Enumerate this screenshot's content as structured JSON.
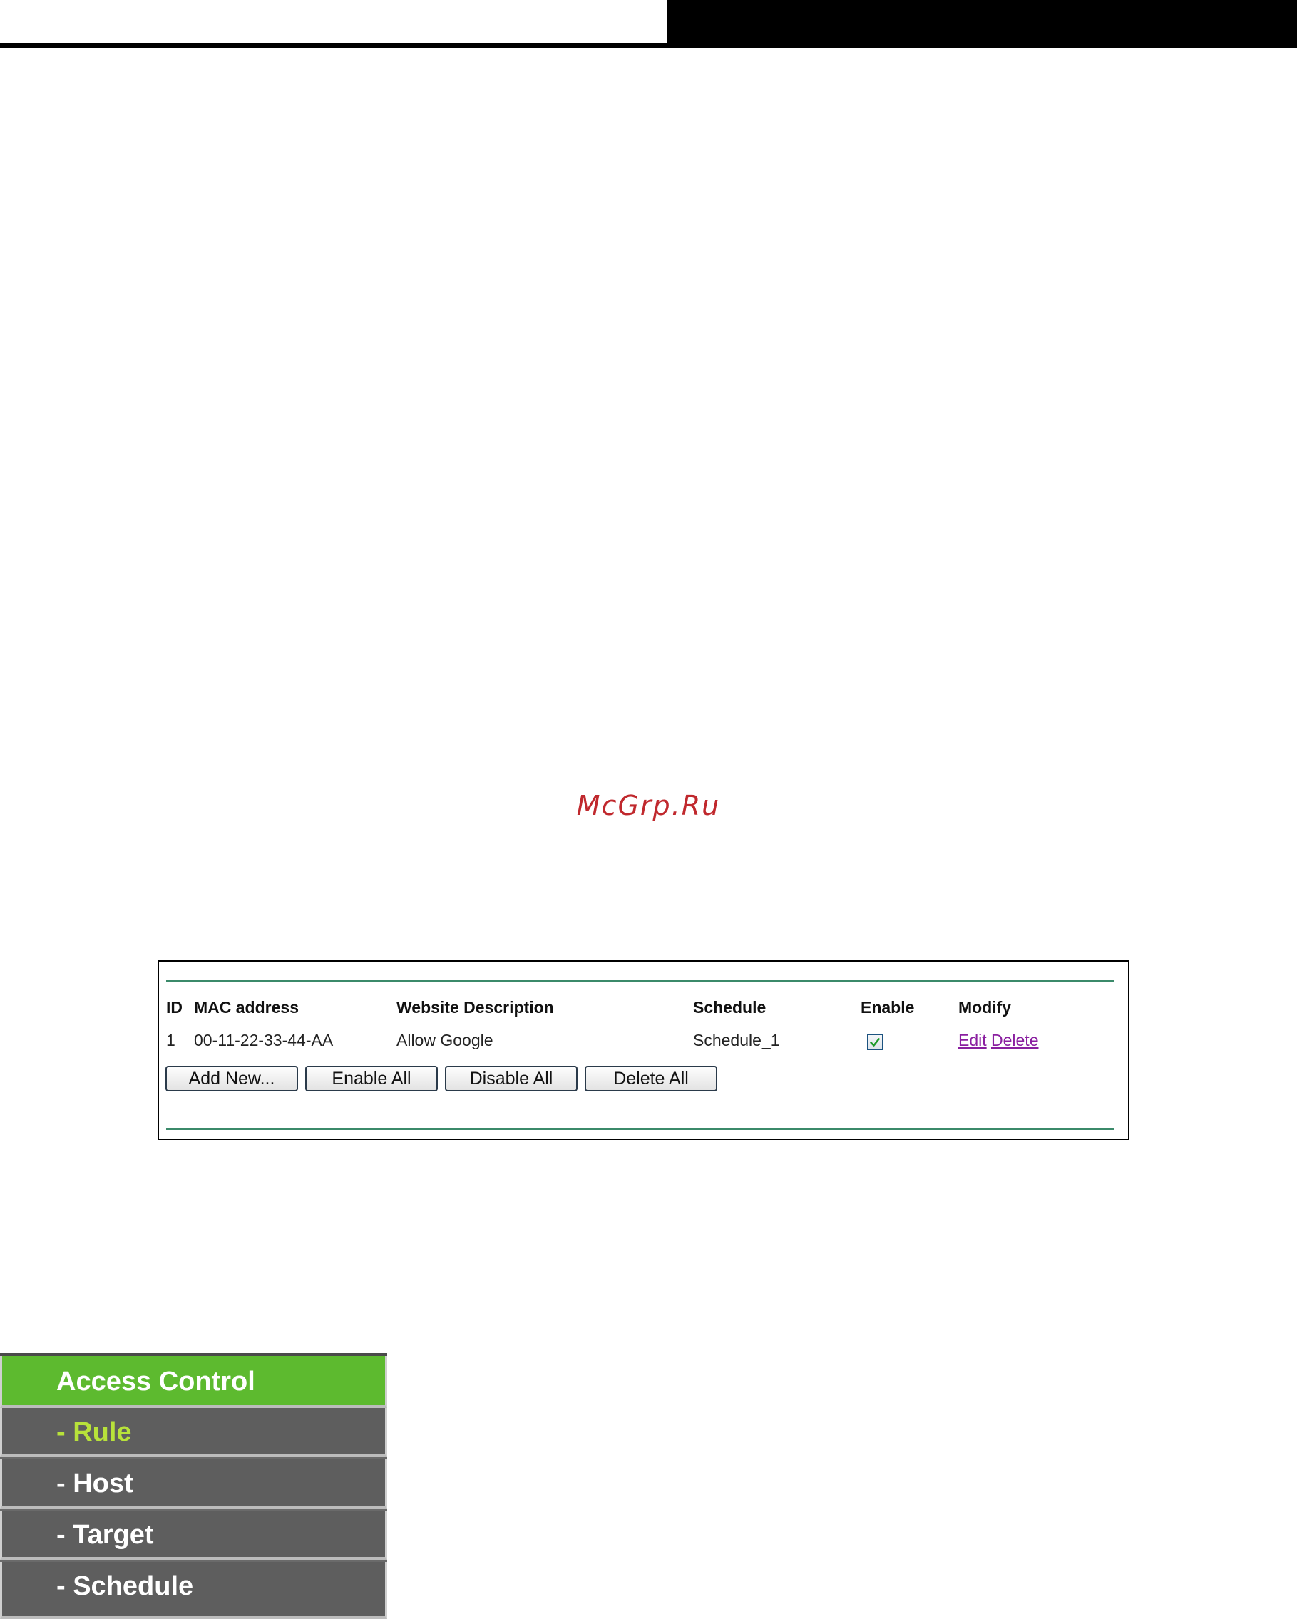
{
  "watermark": "McGrp.Ru",
  "rule_table": {
    "headers": {
      "id": "ID",
      "mac": "MAC address",
      "description": "Website Description",
      "schedule": "Schedule",
      "enable": "Enable",
      "modify": "Modify"
    },
    "rows": [
      {
        "id": "1",
        "mac": "00-11-22-33-44-AA",
        "description": "Allow Google",
        "schedule": "Schedule_1",
        "enabled": true,
        "edit_label": "Edit",
        "delete_label": "Delete"
      }
    ],
    "buttons": {
      "add_new": "Add New...",
      "enable_all": "Enable All",
      "disable_all": "Disable All",
      "delete_all": "Delete All"
    }
  },
  "menu": {
    "header": "Access Control",
    "items": [
      {
        "label": "- Rule",
        "active": true
      },
      {
        "label": "- Host",
        "active": false
      },
      {
        "label": "- Target",
        "active": false
      },
      {
        "label": "- Schedule",
        "active": false
      }
    ]
  },
  "colors": {
    "watermark": "#c0282d",
    "table_rule": "#3b8a6a",
    "link": "#8a1fa0",
    "menu_header_bg": "#5dba2f",
    "menu_bg": "#5e5e5e",
    "menu_active_text": "#b8e23a"
  }
}
